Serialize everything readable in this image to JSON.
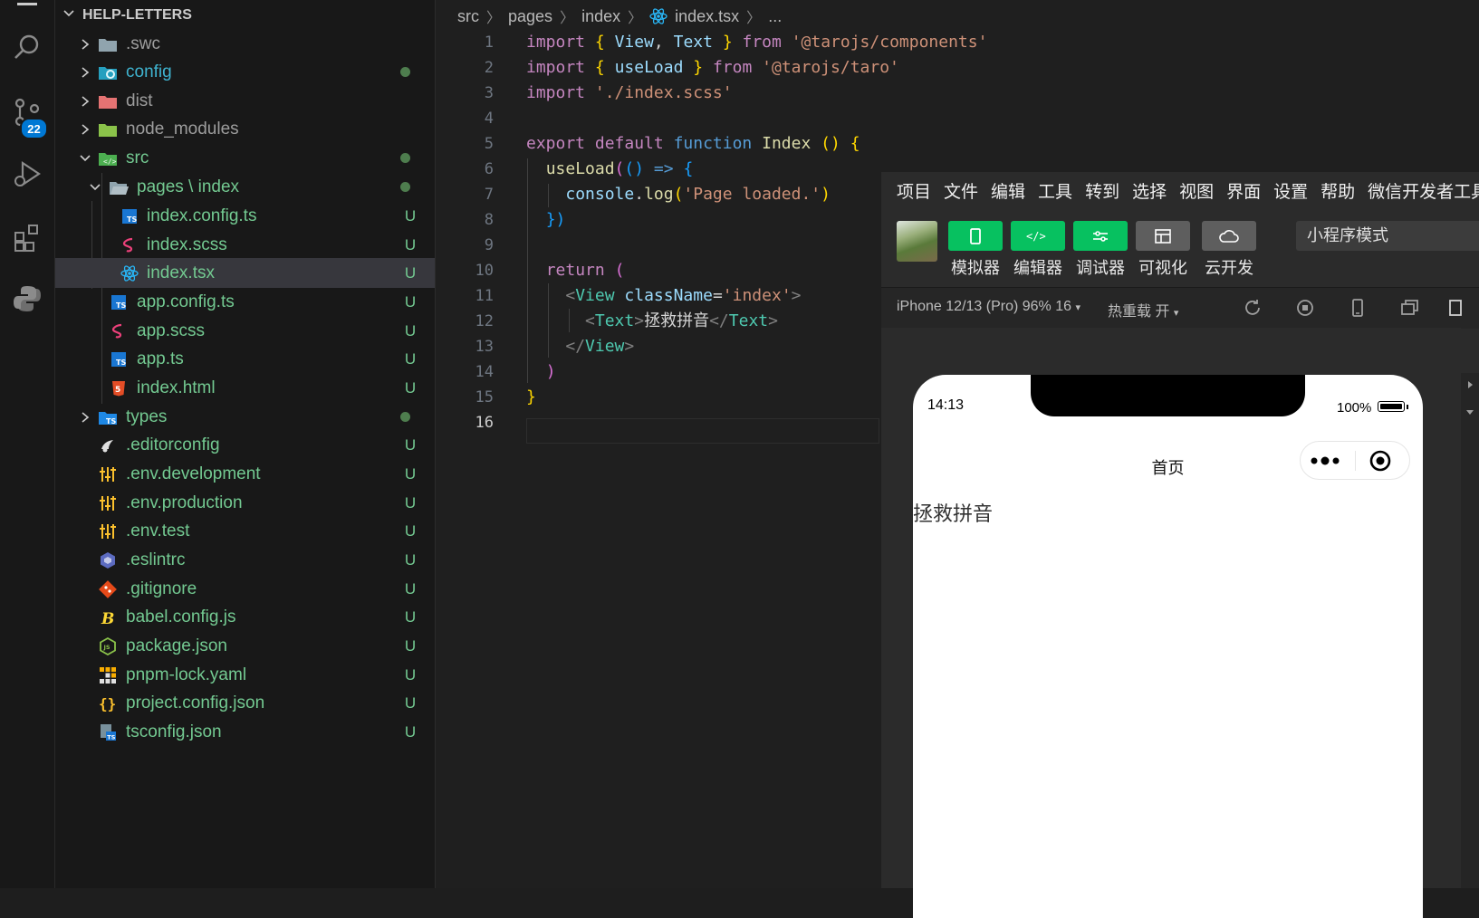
{
  "explorer": {
    "title": "HELP-LETTERS",
    "items": [
      {
        "name": ".swc",
        "status": "",
        "dot": false
      },
      {
        "name": "config",
        "status": "",
        "dot": true
      },
      {
        "name": "dist",
        "status": "",
        "dot": false
      },
      {
        "name": "node_modules",
        "status": "",
        "dot": false
      },
      {
        "name": "src",
        "status": "",
        "dot": true
      },
      {
        "name": "pages \\ index",
        "status": "",
        "dot": true
      },
      {
        "name": "index.config.ts",
        "status": "U",
        "dot": false
      },
      {
        "name": "index.scss",
        "status": "U",
        "dot": false
      },
      {
        "name": "index.tsx",
        "status": "U",
        "dot": false
      },
      {
        "name": "app.config.ts",
        "status": "U",
        "dot": false
      },
      {
        "name": "app.scss",
        "status": "U",
        "dot": false
      },
      {
        "name": "app.ts",
        "status": "U",
        "dot": false
      },
      {
        "name": "index.html",
        "status": "U",
        "dot": false
      },
      {
        "name": "types",
        "status": "",
        "dot": true
      },
      {
        "name": ".editorconfig",
        "status": "U",
        "dot": false
      },
      {
        "name": ".env.development",
        "status": "U",
        "dot": false
      },
      {
        "name": ".env.production",
        "status": "U",
        "dot": false
      },
      {
        "name": ".env.test",
        "status": "U",
        "dot": false
      },
      {
        "name": ".eslintrc",
        "status": "U",
        "dot": false
      },
      {
        "name": ".gitignore",
        "status": "U",
        "dot": false
      },
      {
        "name": "babel.config.js",
        "status": "U",
        "dot": false
      },
      {
        "name": "package.json",
        "status": "U",
        "dot": false
      },
      {
        "name": "pnpm-lock.yaml",
        "status": "U",
        "dot": false
      },
      {
        "name": "project.config.json",
        "status": "U",
        "dot": false
      },
      {
        "name": "tsconfig.json",
        "status": "U",
        "dot": false
      }
    ]
  },
  "activity": {
    "scm_badge": "22"
  },
  "breadcrumb": {
    "parts": [
      "src",
      "pages",
      "index",
      "index.tsx",
      "..."
    ]
  },
  "editor": {
    "line_numbers": [
      "1",
      "2",
      "3",
      "4",
      "5",
      "6",
      "7",
      "8",
      "9",
      "10",
      "11",
      "12",
      "13",
      "14",
      "15",
      "16"
    ],
    "active_line": "16",
    "code": {
      "l1": {
        "import": "import",
        "b_open": "{",
        "id1": "View",
        "comma": ",",
        "id2": "Text",
        "b_close": "}",
        "from": "from",
        "str": "'@tarojs/components'"
      },
      "l2": {
        "import": "import",
        "b_open": "{",
        "id1": "useLoad",
        "b_close": "}",
        "from": "from",
        "str": "'@tarojs/taro'"
      },
      "l3": {
        "import": "import",
        "str": "'./index.scss'"
      },
      "l5": {
        "export": "export",
        "default": "default",
        "function": "function",
        "name": "Index",
        "parens": "()",
        "brace": "{"
      },
      "l6": {
        "fn": "useLoad",
        "p_open": "(",
        "args": "()",
        "arrow": "=>",
        "brace": "{"
      },
      "l7": {
        "obj": "console",
        "dot": ".",
        "fn": "log",
        "p_open": "(",
        "str": "'Page loaded.'",
        "p_close": ")"
      },
      "l8": {
        "close": "})"
      },
      "l10": {
        "return": "return",
        "p_open": "("
      },
      "l11": {
        "lt": "<",
        "tag": "View",
        "attr": "className",
        "eq": "=",
        "str": "'index'",
        "gt": ">"
      },
      "l12": {
        "lt": "<",
        "tag": "Text",
        "gt": ">",
        "text": "拯救拼音",
        "close_lt": "</",
        "close_tag": "Text",
        "close_gt": ">"
      },
      "l13": {
        "lt": "</",
        "tag": "View",
        "gt": ">"
      },
      "l14": {
        "p_close": ")"
      },
      "l15": {
        "brace": "}"
      }
    }
  },
  "devtools": {
    "menu": [
      "项目",
      "文件",
      "编辑",
      "工具",
      "转到",
      "选择",
      "视图",
      "界面",
      "设置",
      "帮助",
      "微信开发者工具"
    ],
    "toolbar": {
      "buttons": [
        "模拟器",
        "编辑器",
        "调试器",
        "可视化",
        "云开发"
      ],
      "mode": "小程序模式"
    },
    "simbar": {
      "device": "iPhone 12/13 (Pro) 96% 16",
      "hot_reload": "热重载 开"
    },
    "phone": {
      "time": "14:13",
      "battery": "100%",
      "battery_level": 1.0,
      "nav_title": "首页",
      "page_text": "拯救拼音"
    }
  }
}
